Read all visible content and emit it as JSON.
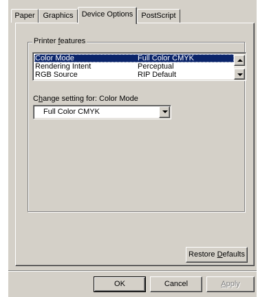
{
  "tabs": [
    {
      "label": "Paper"
    },
    {
      "label": "Graphics"
    },
    {
      "label": "Device Options"
    },
    {
      "label": "PostScript"
    }
  ],
  "active_tab": "Device Options",
  "printer_features": {
    "group_label_pre": "Printer ",
    "group_label_hot": "f",
    "group_label_post": "eatures",
    "rows": [
      {
        "name": "Color Mode",
        "value": "Full Color CMYK",
        "selected": true
      },
      {
        "name": "Rendering Intent",
        "value": "Perceptual",
        "selected": false
      },
      {
        "name": "RGB Source",
        "value": "RIP Default",
        "selected": false
      }
    ]
  },
  "change_setting": {
    "label_pre": "C",
    "label_hot": "h",
    "label_post": "ange setting for:  Color Mode",
    "selected_value": "Full Color CMYK"
  },
  "restore_defaults": {
    "label_pre": "Restore ",
    "label_hot": "D",
    "label_post": "efaults"
  },
  "footer": {
    "ok_label": "OK",
    "cancel_label": "Cancel",
    "apply_label_hot": "A",
    "apply_label_post": "pply"
  },
  "colors": {
    "dialog_face": "#d4d0c8",
    "selection": "#0a246a"
  }
}
